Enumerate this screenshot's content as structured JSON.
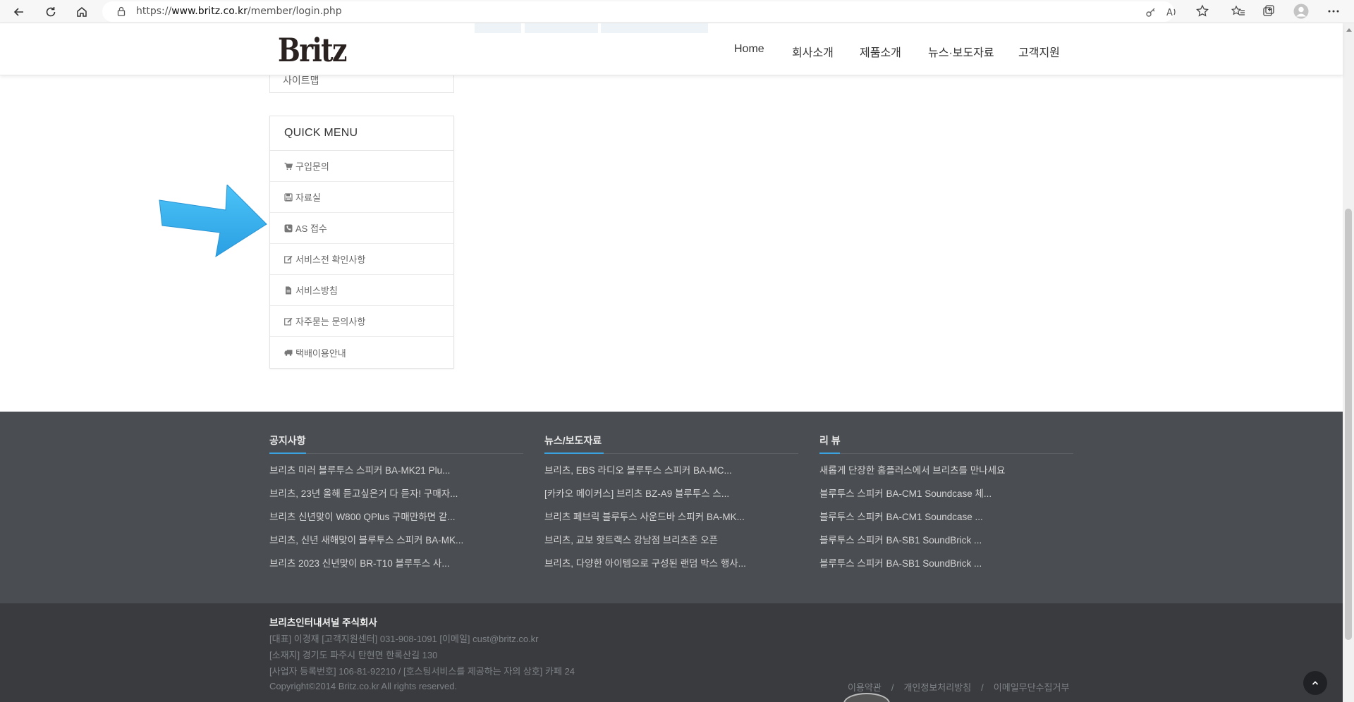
{
  "browser": {
    "url_prefix": "https://",
    "url_domain": "www.britz.co.kr",
    "url_path": "/member/login.php"
  },
  "header": {
    "logo": "Britz",
    "nav": [
      "Home",
      "회사소개",
      "제품소개",
      "뉴스·보도자료",
      "고객지원"
    ]
  },
  "sidebar_prev": {
    "label": "사이트맵"
  },
  "quick_menu": {
    "title": "QUICK MENU",
    "items": [
      {
        "icon": "cart-icon",
        "label": "구입문의"
      },
      {
        "icon": "save-icon",
        "label": "자료실"
      },
      {
        "icon": "phone-icon",
        "label": "AS 접수"
      },
      {
        "icon": "edit-icon",
        "label": "서비스전 확인사항"
      },
      {
        "icon": "document-icon",
        "label": "서비스방침"
      },
      {
        "icon": "edit-icon",
        "label": "자주묻는 문의사항"
      },
      {
        "icon": "truck-icon",
        "label": "택배이용안내"
      }
    ]
  },
  "annotation": {
    "arrow_color": "#3ab1ee"
  },
  "footer": {
    "columns": [
      {
        "title": "공지사항",
        "items": [
          "브리츠 미러 블루투스 스피커 BA-MK21 Plu...",
          "브리츠, 23년 올해 듣고싶은거 다 듣자! 구매자...",
          "브리츠 신년맞이 W800 QPlus 구매만하면 같...",
          "브리츠, 신년 새해맞이 블루투스 스피커 BA-MK...",
          "브리츠 2023 신년맞이 BR-T10 블루투스 사..."
        ]
      },
      {
        "title": "뉴스/보도자료",
        "items": [
          "브리츠, EBS 라디오 블루투스 스피커 BA-MC...",
          "[카카오 메이커스] 브리츠 BZ-A9 블루투스 스...",
          "브리츠 페브릭 블루투스 사운드바 스피커 BA-MK...",
          "브리츠, 교보 핫트랙스 강남점 브리츠존 오픈",
          "브리츠, 다양한 아이템으로 구성된 랜덤 박스 행사..."
        ]
      },
      {
        "title": "리 뷰",
        "items": [
          "새롭게 단장한 홈플러스에서 브리츠를 만나세요",
          "블루투스 스피커 BA-CM1 Soundcase 체...",
          "블루투스 스피커 BA-CM1 Soundcase ...",
          "블루투스 스피커 BA-SB1 SoundBrick ...",
          "블루투스 스피커 BA-SB1 SoundBrick ..."
        ]
      }
    ],
    "company": {
      "name": "브리츠인터내셔널 주식회사",
      "lines": [
        "[대표] 이경재 [고객지원센터] 031-908-1091 [이메일] cust@britz.co.kr",
        "[소재지] 경기도 파주시 탄현면 한록산길 130",
        "[사업자 등록번호] 106-81-92210 / [호스팅서비스를 제공하는 자의 상호] 카페 24",
        "Copyright©2014 Britz.co.kr All rights reserved."
      ]
    },
    "links": [
      "이용약관",
      "개인정보처리방침",
      "이메일무단수집거부"
    ],
    "link_separator": "/"
  },
  "colors": {
    "footer_top": "#4a4d51",
    "footer_bottom": "#393b3e",
    "accent": "#3aa2de"
  }
}
